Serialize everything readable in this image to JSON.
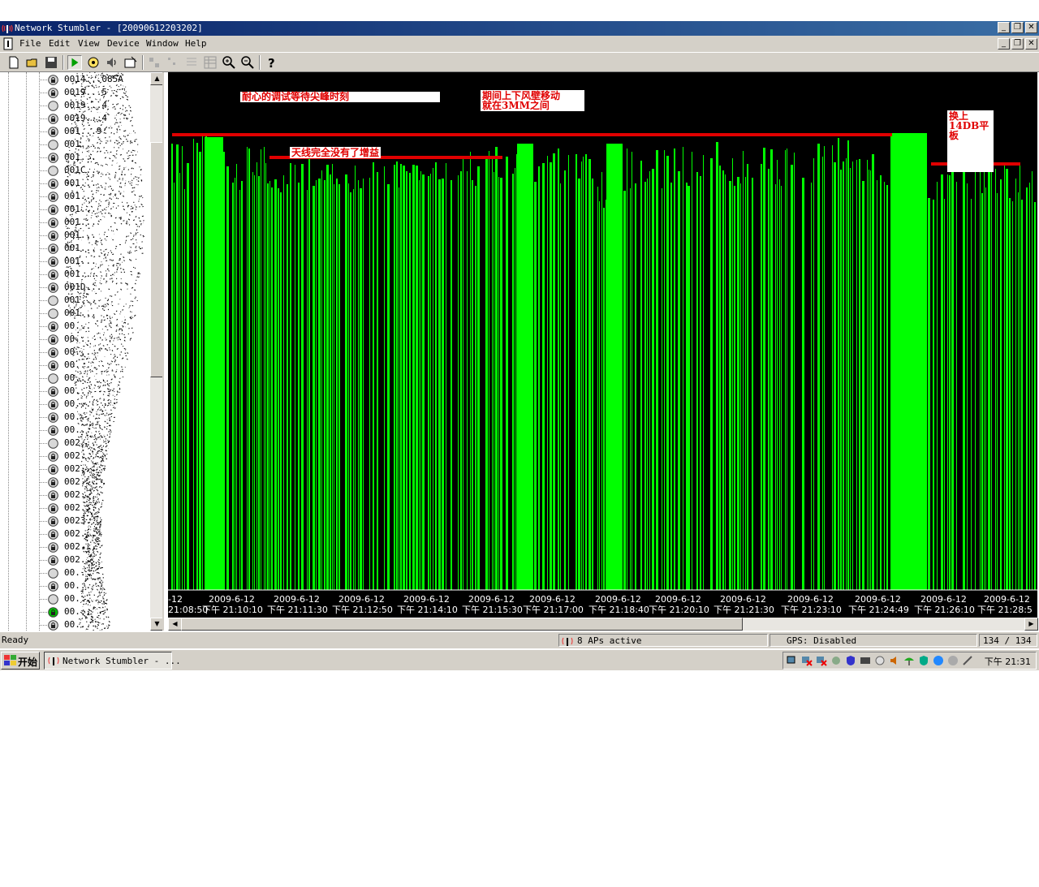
{
  "window": {
    "title": "Network Stumbler - [20090612203202]",
    "controls": [
      "_",
      "❐",
      "✕"
    ]
  },
  "menu": {
    "items": [
      "File",
      "Edit",
      "View",
      "Device",
      "Window",
      "Help"
    ],
    "child_controls": [
      "_",
      "❐",
      "✕"
    ]
  },
  "toolbar": {
    "icons": [
      "new-icon",
      "open-icon",
      "save-icon",
      "play-icon",
      "scan-options-icon",
      "speaker-icon",
      "properties-icon",
      "large-icons-icon",
      "small-icons-icon",
      "list-icon",
      "details-icon",
      "zoom-in-icon",
      "zoom-out-icon",
      "help-icon"
    ]
  },
  "tree": {
    "items": [
      {
        "label": "0014...085A",
        "secure": true
      },
      {
        "label": "0019...5",
        "secure": true
      },
      {
        "label": "0019...4",
        "secure": false
      },
      {
        "label": "0019...4",
        "secure": true
      },
      {
        "label": "001...9",
        "secure": true
      },
      {
        "label": "001...",
        "secure": false
      },
      {
        "label": "001...",
        "secure": true
      },
      {
        "label": "001C...",
        "secure": false
      },
      {
        "label": "001...",
        "secure": true
      },
      {
        "label": "001...",
        "secure": true
      },
      {
        "label": "001...",
        "secure": true
      },
      {
        "label": "001...",
        "secure": true
      },
      {
        "label": "001...",
        "secure": true
      },
      {
        "label": "001...",
        "secure": true
      },
      {
        "label": "001...",
        "secure": true
      },
      {
        "label": "001...",
        "secure": true
      },
      {
        "label": "001D...",
        "secure": true
      },
      {
        "label": "001...",
        "secure": false
      },
      {
        "label": "001...",
        "secure": false
      },
      {
        "label": "00...",
        "secure": true
      },
      {
        "label": "00...",
        "secure": true
      },
      {
        "label": "00...",
        "secure": true
      },
      {
        "label": "00...",
        "secure": true
      },
      {
        "label": "00...",
        "secure": false
      },
      {
        "label": "00...",
        "secure": true
      },
      {
        "label": "00...",
        "secure": true
      },
      {
        "label": "00...",
        "secure": true
      },
      {
        "label": "00...",
        "secure": true
      },
      {
        "label": "002...",
        "secure": false
      },
      {
        "label": "002...",
        "secure": true
      },
      {
        "label": "002...",
        "secure": true
      },
      {
        "label": "002...",
        "secure": true
      },
      {
        "label": "002...",
        "secure": true
      },
      {
        "label": "002...",
        "secure": true
      },
      {
        "label": "0023...",
        "secure": true
      },
      {
        "label": "002...",
        "secure": true
      },
      {
        "label": "002...",
        "secure": true
      },
      {
        "label": "002...",
        "secure": true
      },
      {
        "label": "00...",
        "secure": false
      },
      {
        "label": "00...",
        "secure": true
      },
      {
        "label": "00...",
        "secure": false
      },
      {
        "label": "00...",
        "secure": true,
        "active": true
      },
      {
        "label": "00...",
        "secure": true
      }
    ]
  },
  "graph": {
    "annotations": {
      "a1": "耐心的调试等待尖峰时刻",
      "a2": "期间上下风壁移动\n就在3MM之间",
      "a3": "天线完全没有了增益",
      "a4": "换上\n14DB平\n板"
    },
    "time_labels": [
      {
        "date": "-12",
        "time": "21:08:50"
      },
      {
        "date": "2009-6-12",
        "time": "下午 21:10:10"
      },
      {
        "date": "2009-6-12",
        "time": "下午 21:11:30"
      },
      {
        "date": "2009-6-12",
        "time": "下午 21:12:50"
      },
      {
        "date": "2009-6-12",
        "time": "下午 21:14:10"
      },
      {
        "date": "2009-6-12",
        "time": "下午 21:15:30"
      },
      {
        "date": "2009-6-12",
        "time": "下午 21:17:00"
      },
      {
        "date": "2009-6-12",
        "time": "下午 21:18:40"
      },
      {
        "date": "2009-6-12",
        "time": "下午 21:20:10"
      },
      {
        "date": "2009-6-12",
        "time": "下午 21:21:30"
      },
      {
        "date": "2009-6-12",
        "time": "下午 21:23:10"
      },
      {
        "date": "2009-6-12",
        "time": "下午 21:24:49"
      },
      {
        "date": "2009-6-12",
        "time": "下午 21:26:10"
      },
      {
        "date": "2009-6-12",
        "time": "下午 21:28:5"
      }
    ],
    "colors": {
      "bar": "#00ff00",
      "background": "#000000",
      "annotation": "#e00000"
    }
  },
  "statusbar": {
    "ready": "Ready",
    "aps": "8 APs active",
    "gps": "GPS: Disabled",
    "count": "134 / 134"
  },
  "taskbar": {
    "start": "开始",
    "task": "Network Stumbler - ...",
    "clock": "下午 21:31"
  }
}
